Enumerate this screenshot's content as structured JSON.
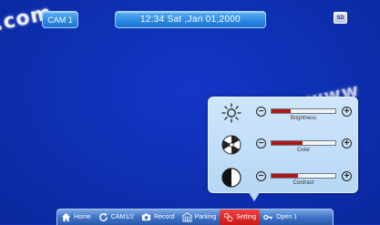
{
  "watermark": {
    "left_text": ".com",
    "right_text": "www"
  },
  "header": {
    "camera_label": "CAM 1",
    "datetime": "12:34 Sat ,Jan 01,2000",
    "sd_badge": "SD"
  },
  "image_settings": {
    "sliders": [
      {
        "name": "brightness",
        "label": "Brightness",
        "icon": "sun-icon",
        "level": 0.3
      },
      {
        "name": "color",
        "label": "Color",
        "icon": "color-wheel-icon",
        "level": 0.48
      },
      {
        "name": "contrast",
        "label": "Contrast",
        "icon": "contrast-icon",
        "level": 0.42
      }
    ],
    "minus_symbol": "−",
    "plus_symbol": "+"
  },
  "nav": {
    "items": [
      {
        "label": "Home",
        "icon": "home-icon",
        "active": false
      },
      {
        "label": "CAM1/2",
        "icon": "refresh-icon",
        "active": false
      },
      {
        "label": "Record",
        "icon": "camera-icon",
        "active": false
      },
      {
        "label": "Parking",
        "icon": "parking-icon",
        "active": false
      },
      {
        "label": "Setting",
        "icon": "gear-icon",
        "active": true
      },
      {
        "label": "Open 1",
        "icon": "key-icon",
        "active": false
      }
    ]
  },
  "colors": {
    "background": "#0d2fb0",
    "pill": "#2a86e2",
    "panel": "#b7d7f5",
    "slider_fill": "#b01818",
    "active_tab": "#d82424"
  }
}
